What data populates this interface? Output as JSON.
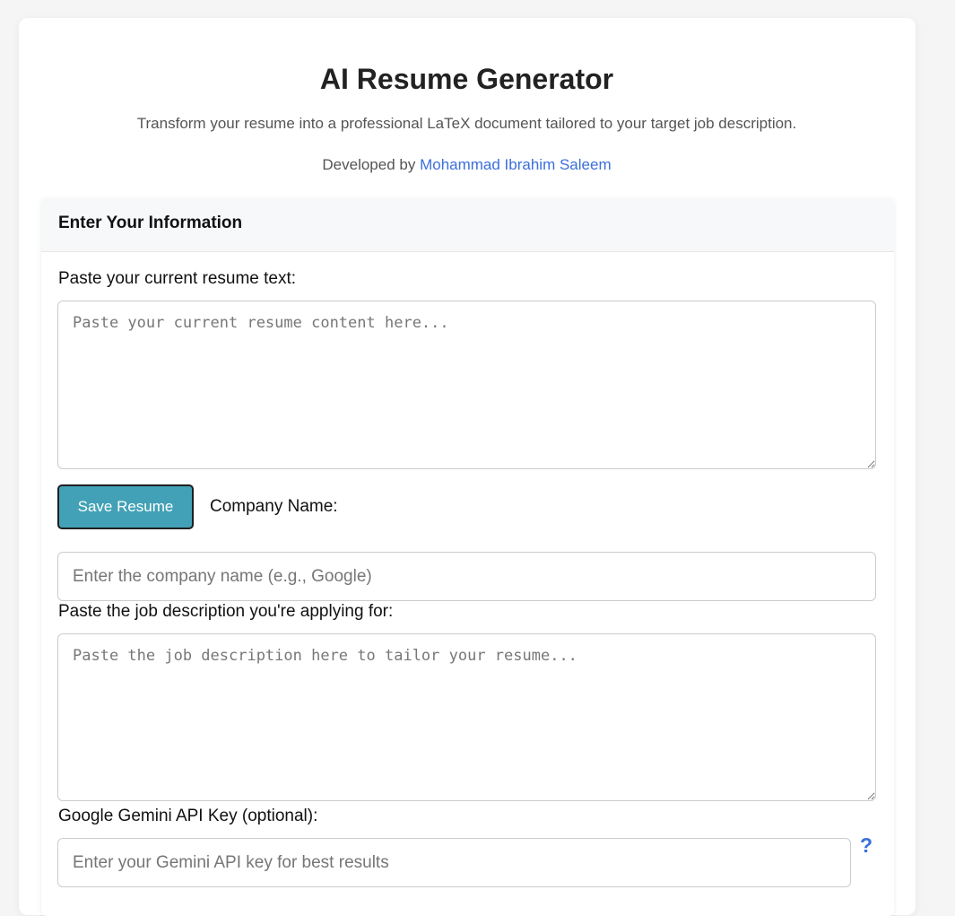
{
  "header": {
    "title": "AI Resume Generator",
    "subtitle": "Transform your resume into a professional LaTeX document tailored to your target job description.",
    "credit_prefix": "Developed by ",
    "credit_author": "Mohammad Ibrahim Saleem"
  },
  "form": {
    "title": "Enter Your Information",
    "resume": {
      "label": "Paste your current resume text:",
      "value": "",
      "placeholder": "Paste your current resume content here..."
    },
    "save_button_label": "Save Resume",
    "company": {
      "label": "Company Name:",
      "value": "",
      "placeholder": "Enter the company name (e.g., Google)"
    },
    "job_description": {
      "label": "Paste the job description you're applying for:",
      "value": "",
      "placeholder": "Paste the job description here to tailor your resume..."
    },
    "api_key": {
      "label": "Google Gemini API Key (optional):",
      "value": "",
      "placeholder": "Enter your Gemini API key for best results",
      "help_icon_glyph": "?"
    }
  },
  "colors": {
    "accent_link": "#3b6fdb",
    "save_button": "#42a1b6"
  },
  "icons": {
    "help": "question-mark-icon"
  }
}
